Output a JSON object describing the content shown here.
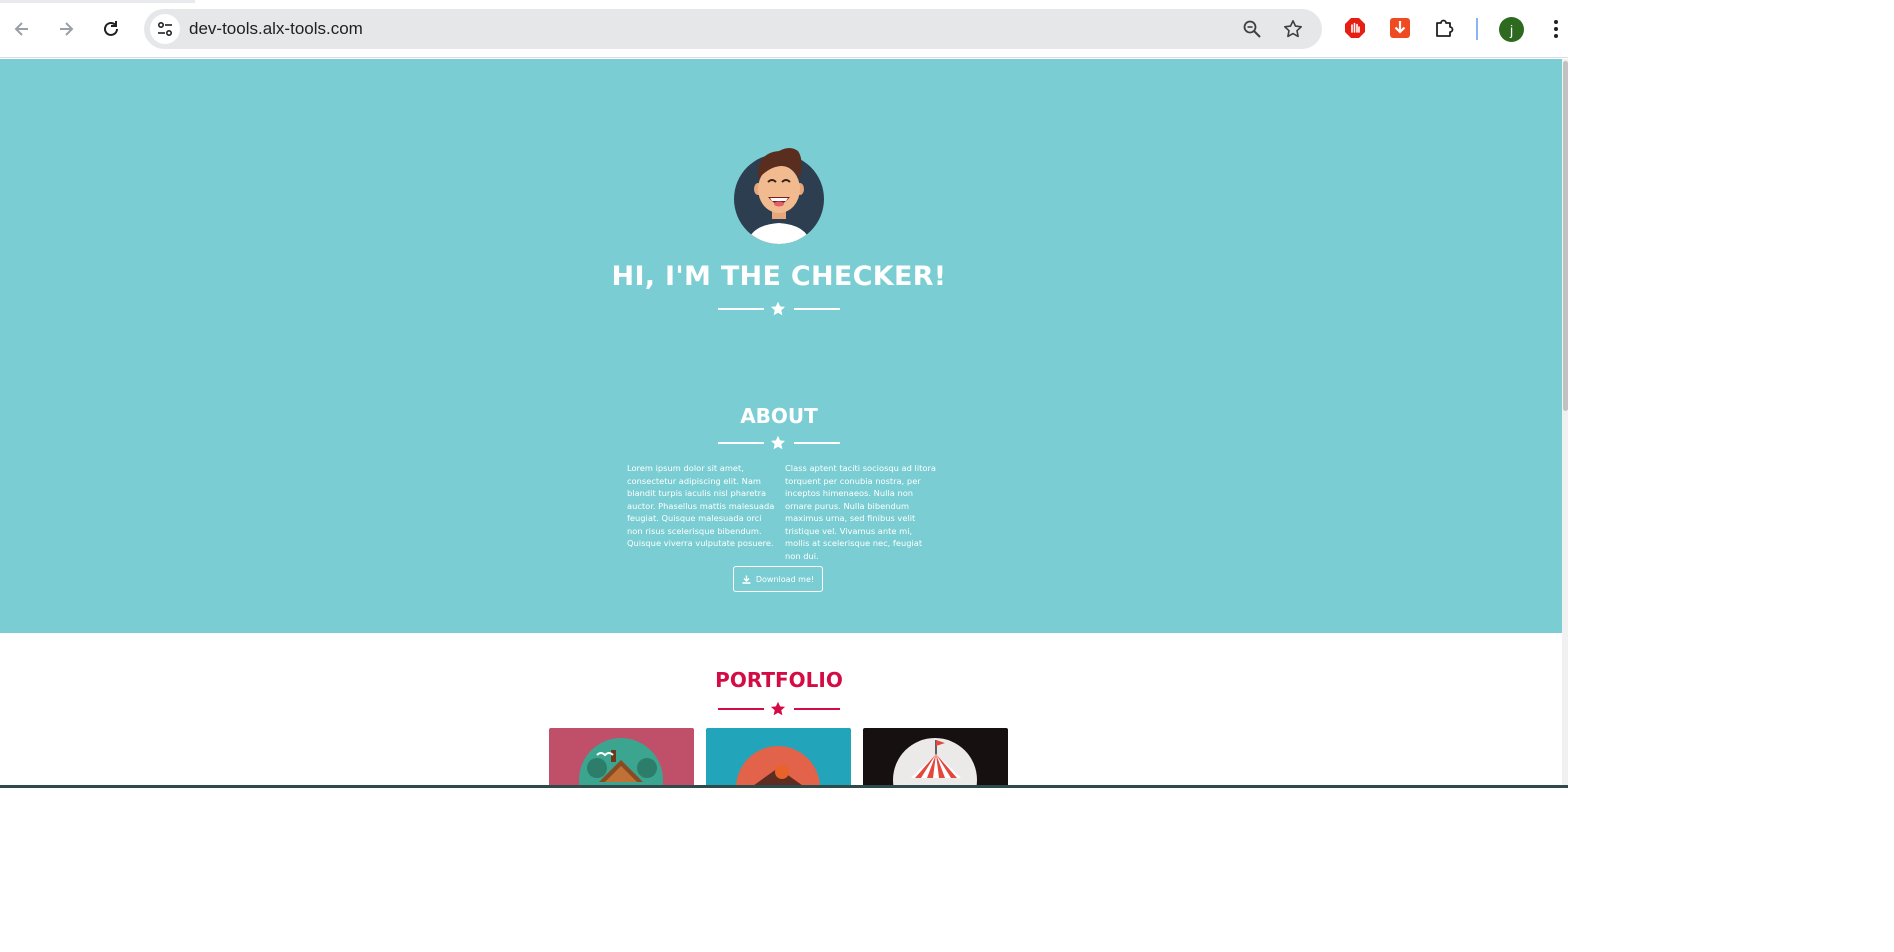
{
  "browser": {
    "url": "dev-tools.alx-tools.com",
    "profile_initial": "j"
  },
  "colors": {
    "hero_bg": "#7acdd2",
    "accent": "#d40c46",
    "tile_1": "#c0506a",
    "tile_2": "#22a5bb",
    "tile_3": "#161110"
  },
  "hero": {
    "title": "HI, I'M THE CHECKER!"
  },
  "about": {
    "title": "ABOUT",
    "col_left": "Lorem ipsum dolor sit amet, consectetur adipiscing elit. Nam blandit turpis iaculis nisl pharetra auctor. Phasellus mattis malesuada feugiat. Quisque malesuada orci non risus scelerisque bibendum. Quisque viverra vulputate posuere.",
    "col_right": "Class aptent taciti sociosqu ad litora torquent per conubia nostra, per inceptos himenaeos. Nulla non ornare purus. Nulla bibendum maximus urna, sed finibus velit tristique vel. Vivamus ante mi, mollis at scelerisque nec, feugiat non dui.",
    "download_label": "Download me!"
  },
  "portfolio": {
    "title": "PORTFOLIO"
  }
}
